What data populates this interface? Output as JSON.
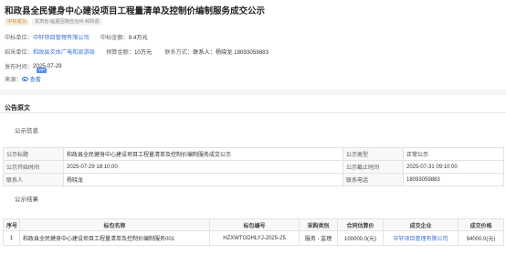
{
  "header": {
    "title": "和政县全民健身中心建设项目工程量清单及控制价编制服务成交公示",
    "tags": [
      "中标成功",
      "甘肃省-临夏回族自治州-和政县"
    ]
  },
  "summary": {
    "winner_label": "中标单位：",
    "winner_value": "中轩项目管理有限公司",
    "amount_label": "中标金额：",
    "amount_value": "9.4万元",
    "tender_label": "招采单位：",
    "tender_value": "和政县文体广电和旅游局",
    "budget_label": "预算金额：",
    "budget_value": "10万元",
    "contact_label": "联系方式：",
    "contact_value": "联系人：杨晓龙 18093059883",
    "date_label": "发布时间：",
    "date_value": "2025-07-29",
    "source_label": "来源：",
    "source_link": "查看",
    "badge": "VIP"
  },
  "section": {
    "title": "公告原文",
    "info_heading": "公示信息",
    "result_heading": "公示结果"
  },
  "info_table": {
    "rows": [
      [
        "公示标题",
        "和政县全民健身中心建设项目工程量清单及控制价编制服务成交公示",
        "公示类型",
        "正常公示"
      ],
      [
        "公示开始时间",
        "2025-07-29 18:10:00",
        "公示截止时间",
        "2025-07-31 09:10:00"
      ],
      [
        "联系人",
        "杨晓龙",
        "联系电话",
        "18093059883"
      ]
    ]
  },
  "result_table": {
    "headers": [
      "序号",
      "标包名称",
      "标包编号",
      "采购类别",
      "合同估算价",
      "成交企业",
      "成交价格"
    ],
    "rows": [
      [
        "1",
        "和政县全民健身中心建设项目工程量清单及控制价编制服务001",
        "HZXWTGDHLYJ-2025-25",
        "服务 - 监理",
        "100000.0(元)",
        "中轩项目管理有限公司",
        "94000.0(元)"
      ]
    ]
  }
}
